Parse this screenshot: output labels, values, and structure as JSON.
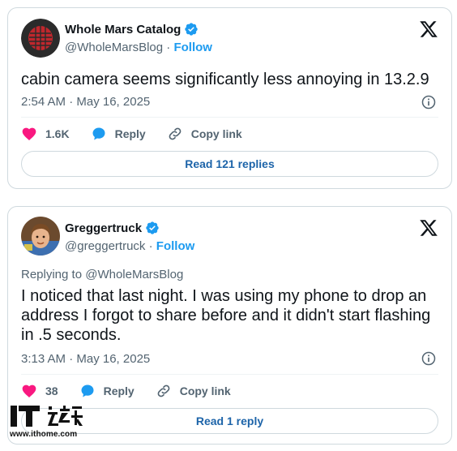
{
  "tweets": [
    {
      "author_name": "Whole Mars Catalog",
      "handle": "@WholeMarsBlog",
      "separator": " · ",
      "follow_label": "Follow",
      "text": "cabin camera seems significantly less annoying in 13.2.9",
      "timestamp": "2:54 AM · May 16, 2025",
      "likes": "1.6K",
      "reply_label": "Reply",
      "copy_link_label": "Copy link",
      "read_replies_label": "Read 121 replies",
      "icons": [
        "verified-badge-icon",
        "x-logo-icon",
        "info-icon",
        "heart-icon",
        "reply-bubble-icon",
        "link-icon"
      ]
    },
    {
      "author_name": "Greggertruck",
      "handle": "@greggertruck",
      "separator": " · ",
      "follow_label": "Follow",
      "replying_to": "Replying to @WholeMarsBlog",
      "text": "I noticed that last night. I was using my phone to drop an address I forgot to share before and it didn't start flashing in .5 seconds.",
      "timestamp": "3:13 AM · May 16, 2025",
      "likes": "38",
      "reply_label": "Reply",
      "copy_link_label": "Copy link",
      "read_replies_label": "Read 1 reply",
      "icons": [
        "verified-badge-icon",
        "x-logo-icon",
        "info-icon",
        "heart-icon",
        "reply-bubble-icon",
        "link-icon"
      ]
    }
  ],
  "watermark": {
    "logo_text": "IT之家",
    "url": "www.ithome.com"
  },
  "colors": {
    "accent": "#1d9bf0",
    "like": "#f91880",
    "secondary_text": "#536471",
    "primary_text": "#0f1419",
    "border": "#cfd9de"
  }
}
